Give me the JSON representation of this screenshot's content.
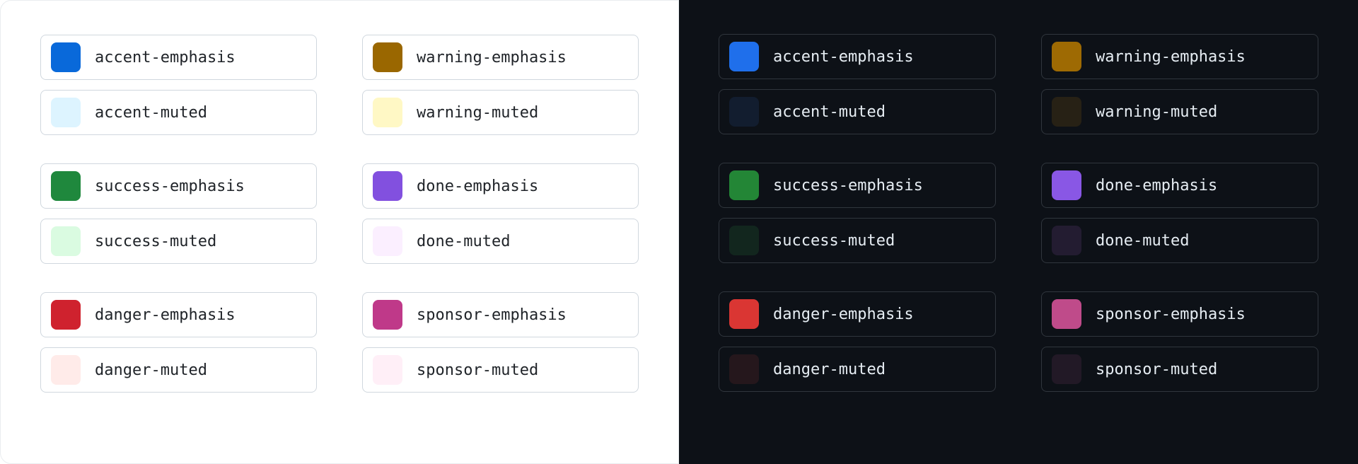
{
  "themes": [
    {
      "id": "light",
      "bg": "#ffffff",
      "border": "#d0d7de",
      "text": "#1f2328",
      "groups": [
        [
          {
            "label": "accent-emphasis",
            "color": "#0969da"
          },
          {
            "label": "warning-emphasis",
            "color": "#9a6700"
          },
          {
            "label": "accent-muted",
            "color": "#ddf4ff"
          },
          {
            "label": "warning-muted",
            "color": "#fff8c5"
          }
        ],
        [
          {
            "label": "success-emphasis",
            "color": "#1f883d"
          },
          {
            "label": "done-emphasis",
            "color": "#8250df"
          },
          {
            "label": "success-muted",
            "color": "#dafbe1"
          },
          {
            "label": "done-muted",
            "color": "#fbefff"
          }
        ],
        [
          {
            "label": "danger-emphasis",
            "color": "#cf222e"
          },
          {
            "label": "sponsor-emphasis",
            "color": "#bf3989"
          },
          {
            "label": "danger-muted",
            "color": "#ffebe9"
          },
          {
            "label": "sponsor-muted",
            "color": "#ffeff7"
          }
        ]
      ]
    },
    {
      "id": "dark",
      "bg": "#0d1117",
      "border": "#30363d",
      "text": "#e6edf3",
      "groups": [
        [
          {
            "label": "accent-emphasis",
            "color": "#1f6feb"
          },
          {
            "label": "warning-emphasis",
            "color": "#9e6a03"
          },
          {
            "label": "accent-muted",
            "color": "#121d2f"
          },
          {
            "label": "warning-muted",
            "color": "#272115"
          }
        ],
        [
          {
            "label": "success-emphasis",
            "color": "#238636"
          },
          {
            "label": "done-emphasis",
            "color": "#8957e5"
          },
          {
            "label": "success-muted",
            "color": "#12261e"
          },
          {
            "label": "done-muted",
            "color": "#231c31"
          }
        ],
        [
          {
            "label": "danger-emphasis",
            "color": "#da3633"
          },
          {
            "label": "sponsor-emphasis",
            "color": "#bf4b8a"
          },
          {
            "label": "danger-muted",
            "color": "#25171c"
          },
          {
            "label": "sponsor-muted",
            "color": "#221926"
          }
        ]
      ]
    }
  ]
}
